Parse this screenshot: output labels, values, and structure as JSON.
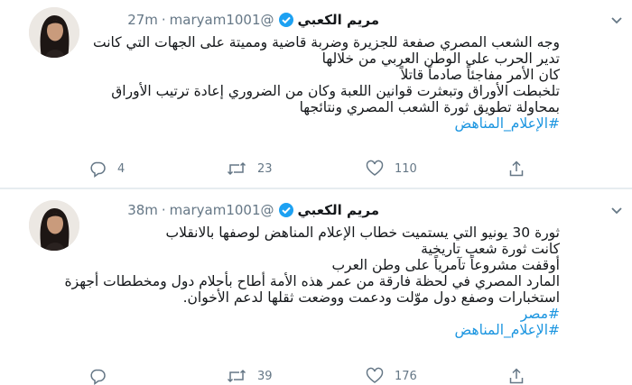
{
  "tweets": [
    {
      "author_name": "مريم الكعبي",
      "handle": "@maryam1001",
      "separator": "·",
      "time": "27m",
      "lines": [
        "وجه الشعب المصري صفعة للجزيرة وضربة قاضية ومميتة على الجهات التي كانت",
        "تدير الحرب على الوطن العربي من خلالها",
        "كان الأمر مفاجئاً صادماً قاتلاً",
        "تلخبطت الأوراق وتبعثرت قوانين اللعبة وكان من الضروري إعادة ترتيب الأوراق",
        "بمحاولة تطويق ثورة الشعب المصري ونتائجها"
      ],
      "hashtags": [
        "#الإعلام_المناهض"
      ],
      "replies": "4",
      "retweets": "23",
      "likes": "110"
    },
    {
      "author_name": "مريم الكعبي",
      "handle": "@maryam1001",
      "separator": "·",
      "time": "38m",
      "lines": [
        "ثورة 30 يونيو التي يستميت خطاب الإعلام المناهض لوصفها بالانقلاب",
        "كانت ثورة شعب تاريخية",
        "أوقفت مشروعاً تآمرياً على وطن العرب",
        "المارد المصري في لحظة فارقة من عمر هذه الأمة أطاح بأحلام دول ومخططات أجهزة",
        "استخبارات وصفع دول موّلت ودعمت ووضعت ثقلها لدعم الأخوان."
      ],
      "hashtags": [
        "#مصر",
        "#الإعلام_المناهض"
      ],
      "replies": "",
      "retweets": "39",
      "likes": "176"
    }
  ],
  "colors": {
    "link": "#1b95e0",
    "muted": "#657786",
    "verified": "#1da1f2"
  },
  "icons": [
    "avatar-photo",
    "verified-badge-icon",
    "chevron-down-icon",
    "reply-icon",
    "retweet-icon",
    "like-icon",
    "share-icon"
  ]
}
